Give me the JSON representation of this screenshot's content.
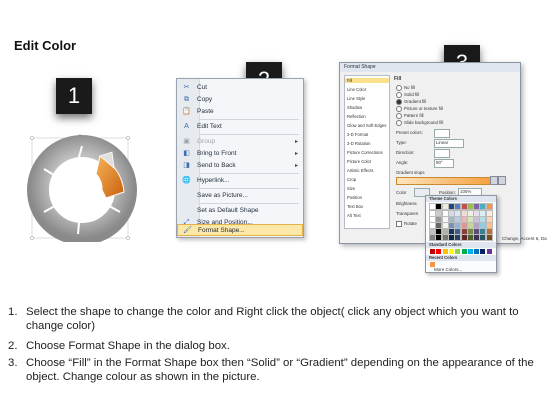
{
  "title": "Edit Color",
  "steps": [
    "1",
    "2",
    "3"
  ],
  "context_menu": {
    "items": [
      {
        "icon": "scissors-icon",
        "glyph": "✂",
        "label": "Cut",
        "disabled": false,
        "arrow": false
      },
      {
        "icon": "copy-icon",
        "glyph": "⧉",
        "label": "Copy",
        "disabled": false,
        "arrow": false
      },
      {
        "icon": "paste-icon",
        "glyph": "📋",
        "label": "Paste",
        "disabled": false,
        "arrow": false
      },
      {
        "icon": "edit-text-icon",
        "glyph": "A",
        "label": "Edit Text",
        "disabled": false,
        "arrow": false
      },
      {
        "icon": "group-icon",
        "glyph": "▣",
        "label": "Group",
        "disabled": true,
        "arrow": true
      },
      {
        "icon": "bring-front-icon",
        "glyph": "◧",
        "label": "Bring to Front",
        "disabled": false,
        "arrow": true
      },
      {
        "icon": "send-back-icon",
        "glyph": "◨",
        "label": "Send to Back",
        "disabled": false,
        "arrow": true
      },
      {
        "icon": "hyperlink-icon",
        "glyph": "🌐",
        "label": "Hyperlink...",
        "disabled": false,
        "arrow": false
      },
      {
        "icon": "",
        "glyph": "",
        "label": "Save as Picture...",
        "disabled": false,
        "arrow": false
      },
      {
        "icon": "",
        "glyph": "",
        "label": "Set as Default Shape",
        "disabled": false,
        "arrow": false
      },
      {
        "icon": "size-position-icon",
        "glyph": "⤢",
        "label": "Size and Position...",
        "disabled": false,
        "arrow": false
      },
      {
        "icon": "format-shape-icon",
        "glyph": "🖌",
        "label": "Format Shape...",
        "disabled": false,
        "arrow": false,
        "selected": true
      }
    ]
  },
  "dialog": {
    "title": "Format Shape",
    "left_items": [
      "Fill",
      "Line Color",
      "Line Style",
      "Shadow",
      "Reflection",
      "Glow and Soft Edges",
      "3-D Format",
      "3-D Rotation",
      "Picture Corrections",
      "Picture Color",
      "Artistic Effects",
      "Crop",
      "Size",
      "Position",
      "Text Box",
      "Alt Text"
    ],
    "section": "Fill",
    "fill_options": [
      "No fill",
      "Solid fill",
      "Gradient fill",
      "Picture or texture fill",
      "Pattern fill",
      "Slide background fill"
    ],
    "preset_colors": "Preset colors:",
    "type_label": "Type:",
    "type_value": "Linear",
    "direction_label": "Direction:",
    "angle_label": "Angle:",
    "angle_value": "90°",
    "gradient_stops": "Gradient stops",
    "color_label": "Color",
    "position_label": "Position:",
    "position_value": "100%",
    "brightness_label": "Brightness",
    "transparency_label": "Transparen",
    "rotate_label": "Rotate",
    "change_text": "Change, Accent 6, Da"
  },
  "palette": {
    "theme_header": "Theme Colors",
    "standard_header": "Standard Colors",
    "recent_header": "Recent Colors",
    "more_colors": "More Colors...",
    "theme_top": [
      "#ffffff",
      "#000000",
      "#eeece1",
      "#1f497d",
      "#4f81bd",
      "#c0504d",
      "#9bbb59",
      "#8064a2",
      "#4bacc6",
      "#f79646"
    ],
    "standard": [
      "#c00000",
      "#ff0000",
      "#ffc000",
      "#ffff00",
      "#92d050",
      "#00b050",
      "#00b0f0",
      "#0070c0",
      "#002060",
      "#7030a0"
    ],
    "recent": [
      "#f79646"
    ]
  },
  "instructions": [
    {
      "num": "1.",
      "text": "Select the shape to change the color and Right click the object( click any object which you want to change color)"
    },
    {
      "num": "2.",
      "text": "Choose Format Shape in the dialog box."
    },
    {
      "num": "3.",
      "text": "Choose “Fill” in the Format Shape box then “Solid” or “Gradient” depending on the appearance of the object. Change colour as shown in the picture."
    }
  ],
  "colors": {
    "accent_orange": "#e07b1a",
    "ring_gray": "#a8a8a8",
    "menu_highlight": "#fbe7a6"
  }
}
